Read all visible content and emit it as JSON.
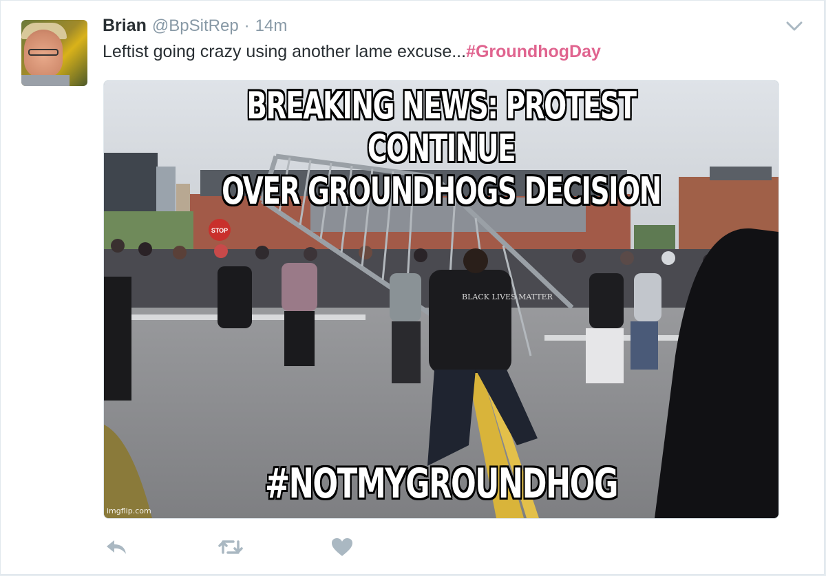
{
  "tweet": {
    "author_name": "Brian",
    "handle": "@BpSitRep",
    "separator": "·",
    "timestamp": "14m",
    "text": "Leftist going crazy using another lame excuse...",
    "hashtag": "#GroundhogDay"
  },
  "media": {
    "top_caption": "BREAKING NEWS: PROTEST CONTINUE\nOVER GROUNDHOGS DECISION",
    "bottom_caption": "#NOTMYGROUNDHOG",
    "watermark": "imgflip.com",
    "sign_text": "STOP",
    "shirt_text": "BLACK LIVES MATTER"
  },
  "actions": {
    "reply_icon": "reply-icon",
    "retweet_icon": "retweet-icon",
    "like_icon": "heart-icon",
    "menu_icon": "chevron-down-icon"
  },
  "colors": {
    "hashtag": "#e0648f",
    "name": "#292f33",
    "meta": "#8899a6",
    "icon": "#aab8c2"
  }
}
